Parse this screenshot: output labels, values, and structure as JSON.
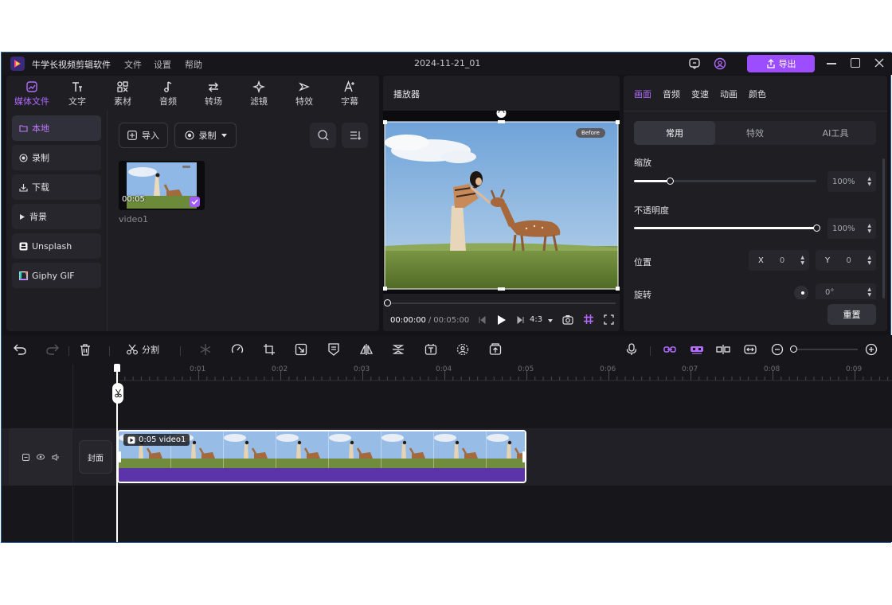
{
  "app": {
    "name": "牛学长视频剪辑软件",
    "menu": [
      "文件",
      "设置",
      "帮助"
    ],
    "project_title": "2024-11-21_01",
    "export_label": "导出"
  },
  "media_tabs": [
    {
      "label": "媒体文件",
      "icon": "media-icon"
    },
    {
      "label": "文字",
      "icon": "text-icon"
    },
    {
      "label": "素材",
      "icon": "elements-icon"
    },
    {
      "label": "音频",
      "icon": "audio-icon"
    },
    {
      "label": "转场",
      "icon": "transition-icon"
    },
    {
      "label": "滤镜",
      "icon": "filter-icon"
    },
    {
      "label": "特效",
      "icon": "effects-icon"
    },
    {
      "label": "字幕",
      "icon": "subtitle-icon"
    }
  ],
  "sidebar": {
    "items": [
      {
        "label": "本地",
        "icon": "folder-icon"
      },
      {
        "label": "录制",
        "icon": "record-icon"
      },
      {
        "label": "下载",
        "icon": "download-icon"
      },
      {
        "label": "背景",
        "icon": "triangle-right-icon"
      },
      {
        "label": "Unsplash",
        "icon": "unsplash-icon"
      },
      {
        "label": "Giphy GIF",
        "icon": "giphy-icon"
      }
    ]
  },
  "media_panel": {
    "import_label": "导入",
    "record_label": "录制",
    "clip": {
      "duration": "00:05",
      "name": "video1"
    }
  },
  "player": {
    "title": "播放器",
    "before_badge": "Before",
    "current_time": "00:00:00",
    "total_time": "00:05:00",
    "separator": "/",
    "aspect": "4:3"
  },
  "properties": {
    "tabs": [
      "画面",
      "音频",
      "变速",
      "动画",
      "颜色"
    ],
    "subtabs": [
      "常用",
      "特效",
      "AI工具"
    ],
    "scale_label": "缩放",
    "scale_value": "100%",
    "scale_level": 0.2,
    "opacity_label": "不透明度",
    "opacity_value": "100%",
    "opacity_level": 1.0,
    "position_label": "位置",
    "pos_x_label": "X",
    "pos_x_value": "0",
    "pos_y_label": "Y",
    "pos_y_value": "0",
    "rotate_label": "旋转",
    "rotate_value": "0°",
    "reset_label": "重置"
  },
  "toolbar": {
    "split_label": "分割"
  },
  "timeline": {
    "ruler": [
      "0:01",
      "0:02",
      "0:03",
      "0:04",
      "0:05",
      "0:06",
      "0:07",
      "0:08",
      "0:09"
    ],
    "cover_label": "封面",
    "clip_label": "0:05 video1"
  },
  "colors": {
    "accent": "#a35bff",
    "export_btn": "#9b4dff",
    "bg": "#141418",
    "panel": "#1e1e23",
    "clip_audio": "#5a34a8"
  }
}
